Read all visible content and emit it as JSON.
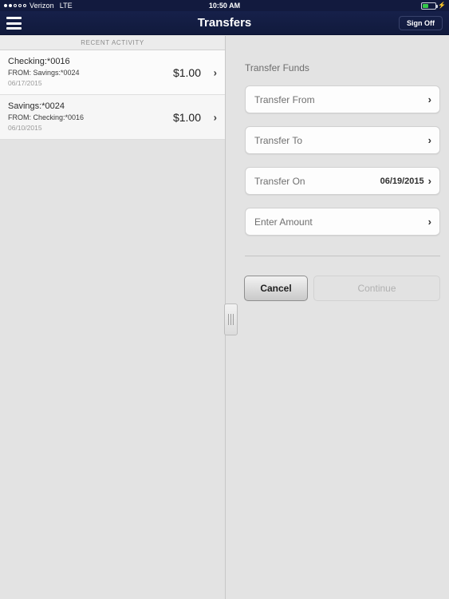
{
  "status_bar": {
    "carrier": "Verizon",
    "network": "LTE",
    "time": "10:50 AM",
    "signal_dots_filled": 2,
    "signal_dots_total": 5,
    "battery_charging": true,
    "battery_color": "#35c84a"
  },
  "navbar": {
    "title": "Transfers",
    "sign_off_label": "Sign Off",
    "menu_icon": "hamburger-icon",
    "background_color": "#131c42"
  },
  "left_panel": {
    "section_header": "RECENT ACTIVITY",
    "activities": [
      {
        "account": "Checking:*0016",
        "from": "FROM: Savings:*0024",
        "date": "06/17/2015",
        "amount": "$1.00",
        "chevron": "chevron-right-icon"
      },
      {
        "account": "Savings:*0024",
        "from": "FROM: Checking:*0016",
        "date": "06/10/2015",
        "amount": "$1.00",
        "chevron": "chevron-right-icon"
      }
    ]
  },
  "right_panel": {
    "form_title": "Transfer Funds",
    "fields": [
      {
        "label": "Transfer From",
        "value": "",
        "chevron": "chevron-right-icon"
      },
      {
        "label": "Transfer To",
        "value": "",
        "chevron": "chevron-right-icon"
      },
      {
        "label": "Transfer On",
        "value": "06/19/2015",
        "chevron": "chevron-right-icon"
      },
      {
        "label": "Enter Amount",
        "value": "",
        "chevron": "chevron-right-icon"
      }
    ],
    "cancel_label": "Cancel",
    "continue_label": "Continue",
    "continue_enabled": false
  },
  "splitter": {
    "name": "panel-resize-handle",
    "grip_lines": 3
  }
}
